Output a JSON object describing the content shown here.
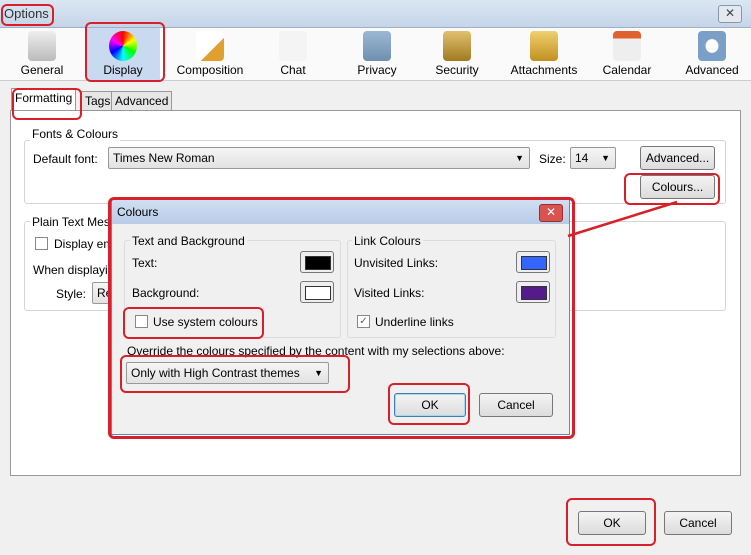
{
  "window": {
    "title": "Options"
  },
  "toolbar": [
    {
      "label": "General",
      "icon": "switch-icon"
    },
    {
      "label": "Display",
      "icon": "display-palette-icon",
      "selected": true
    },
    {
      "label": "Composition",
      "icon": "composition-pencil-icon"
    },
    {
      "label": "Chat",
      "icon": "chat-bubble-icon"
    },
    {
      "label": "Privacy",
      "icon": "mask-icon"
    },
    {
      "label": "Security",
      "icon": "padlock-icon"
    },
    {
      "label": "Attachments",
      "icon": "paperclip-icon"
    },
    {
      "label": "Calendar",
      "icon": "calendar-icon"
    },
    {
      "label": "Advanced",
      "icon": "gear-icon"
    }
  ],
  "tabs": [
    {
      "label": "Formatting",
      "selected": true
    },
    {
      "label": "Tags"
    },
    {
      "label": "Advanced"
    }
  ],
  "fonts": {
    "group_label": "Fonts & Colours",
    "default_font_label": "Default font:",
    "default_font_value": "Times New Roman",
    "size_label": "Size:",
    "size_value": "14",
    "advanced_button": "Advanced...",
    "colours_button": "Colours..."
  },
  "plain": {
    "group_label": "Plain Text Mes",
    "display_label": "Display em",
    "when_label": "When displayi",
    "style_label": "Style:",
    "style_value": "Re"
  },
  "dialog": {
    "title": "Colours",
    "text_bg_label": "Text and Background",
    "text_label": "Text:",
    "text_color": "#000000",
    "background_label": "Background:",
    "background_color": "#ffffff",
    "use_system": "Use system colours",
    "use_system_checked": false,
    "link_label": "Link Colours",
    "unvisited_label": "Unvisited Links:",
    "unvisited_color": "#3366ff",
    "visited_label": "Visited Links:",
    "visited_color": "#551a8b",
    "underline_label": "Underline links",
    "underline_checked": true,
    "override_label": "Override the colours specified by the content with my selections above:",
    "override_value": "Only with High Contrast themes",
    "ok": "OK",
    "cancel": "Cancel"
  },
  "footer": {
    "ok": "OK",
    "cancel": "Cancel"
  },
  "colors": {
    "annotation": "#d8202a",
    "selected_tab_bg": "#c9d9f0"
  }
}
